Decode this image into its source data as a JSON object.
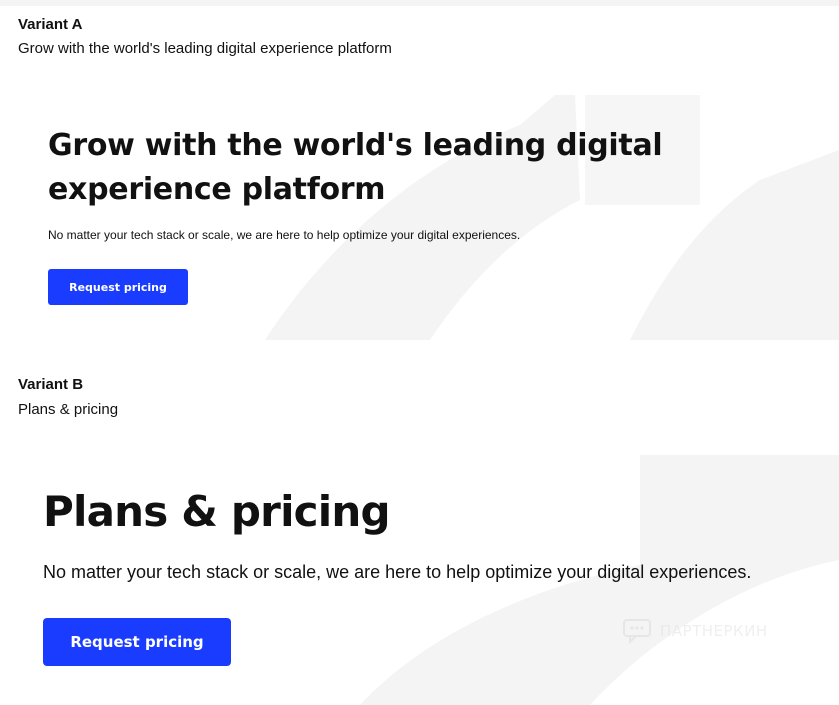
{
  "variant_a": {
    "label": "Variant A",
    "description": "Grow with the world's leading digital experience platform",
    "headline": "Grow with the world's leading digital experience platform",
    "subtext": "No matter your tech stack or scale, we are here to help optimize your digital experiences.",
    "cta_label": "Request pricing"
  },
  "variant_b": {
    "label": "Variant B",
    "description": "Plans & pricing",
    "headline": "Plans & pricing",
    "subtext": "No matter your tech stack or scale, we are here to help optimize your digital experiences.",
    "cta_label": "Request pricing"
  },
  "watermark": {
    "text": "ПАРТНЕРКИН",
    "icon": "chat-bubble-icon"
  },
  "colors": {
    "cta_background": "#1a3cff",
    "cta_text": "#ffffff",
    "decor_shape": "#f3f3f3"
  }
}
